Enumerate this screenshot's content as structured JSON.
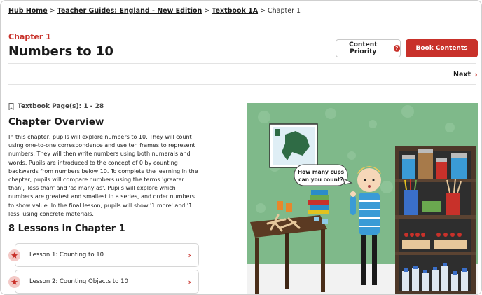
{
  "breadcrumb": {
    "items": [
      "Hub Home",
      "Teacher Guides: England - New Edition",
      "Textbook 1A"
    ],
    "current": "Chapter 1",
    "separator": ">"
  },
  "header": {
    "chapter_label": "Chapter 1",
    "title": "Numbers to 10",
    "priority_button": "Content Priority",
    "priority_help": "?",
    "book_contents_button": "Book Contents"
  },
  "nav": {
    "next_label": "Next",
    "next_chevron": "›"
  },
  "overview": {
    "textbook_pages": "Textbook Page(s): 1 - 28",
    "heading": "Chapter Overview",
    "text": "In this chapter, pupils will explore numbers to 10. They will count using one-to-one correspondence and use ten frames to represent numbers. They will then write numbers using both numerals and words. Pupils are introduced to the concept of 0 by counting backwards from numbers below 10. To complete the learning in the chapter, pupils will compare numbers using the terms 'greater than', 'less than' and 'as many as'. Pupils will explore which numbers are greatest and smallest in a series, and order numbers to show value. In the final lesson, pupils will show '1 more' and '1 less' using concrete materials."
  },
  "lessons": {
    "heading": "8 Lessons in Chapter 1",
    "items": [
      {
        "label": "Lesson 1: Counting to 10"
      },
      {
        "label": "Lesson 2: Counting Objects to 10"
      }
    ],
    "chevron": "›"
  },
  "illustration": {
    "speech_bubble": [
      "How many cups",
      "can you count?"
    ]
  },
  "colors": {
    "accent": "#c8312a",
    "wall": "#7fb98a",
    "floor": "#f2f2f2"
  },
  "icons": [
    "bookmark-icon",
    "help-icon",
    "chevron-right-icon",
    "star-icon"
  ]
}
